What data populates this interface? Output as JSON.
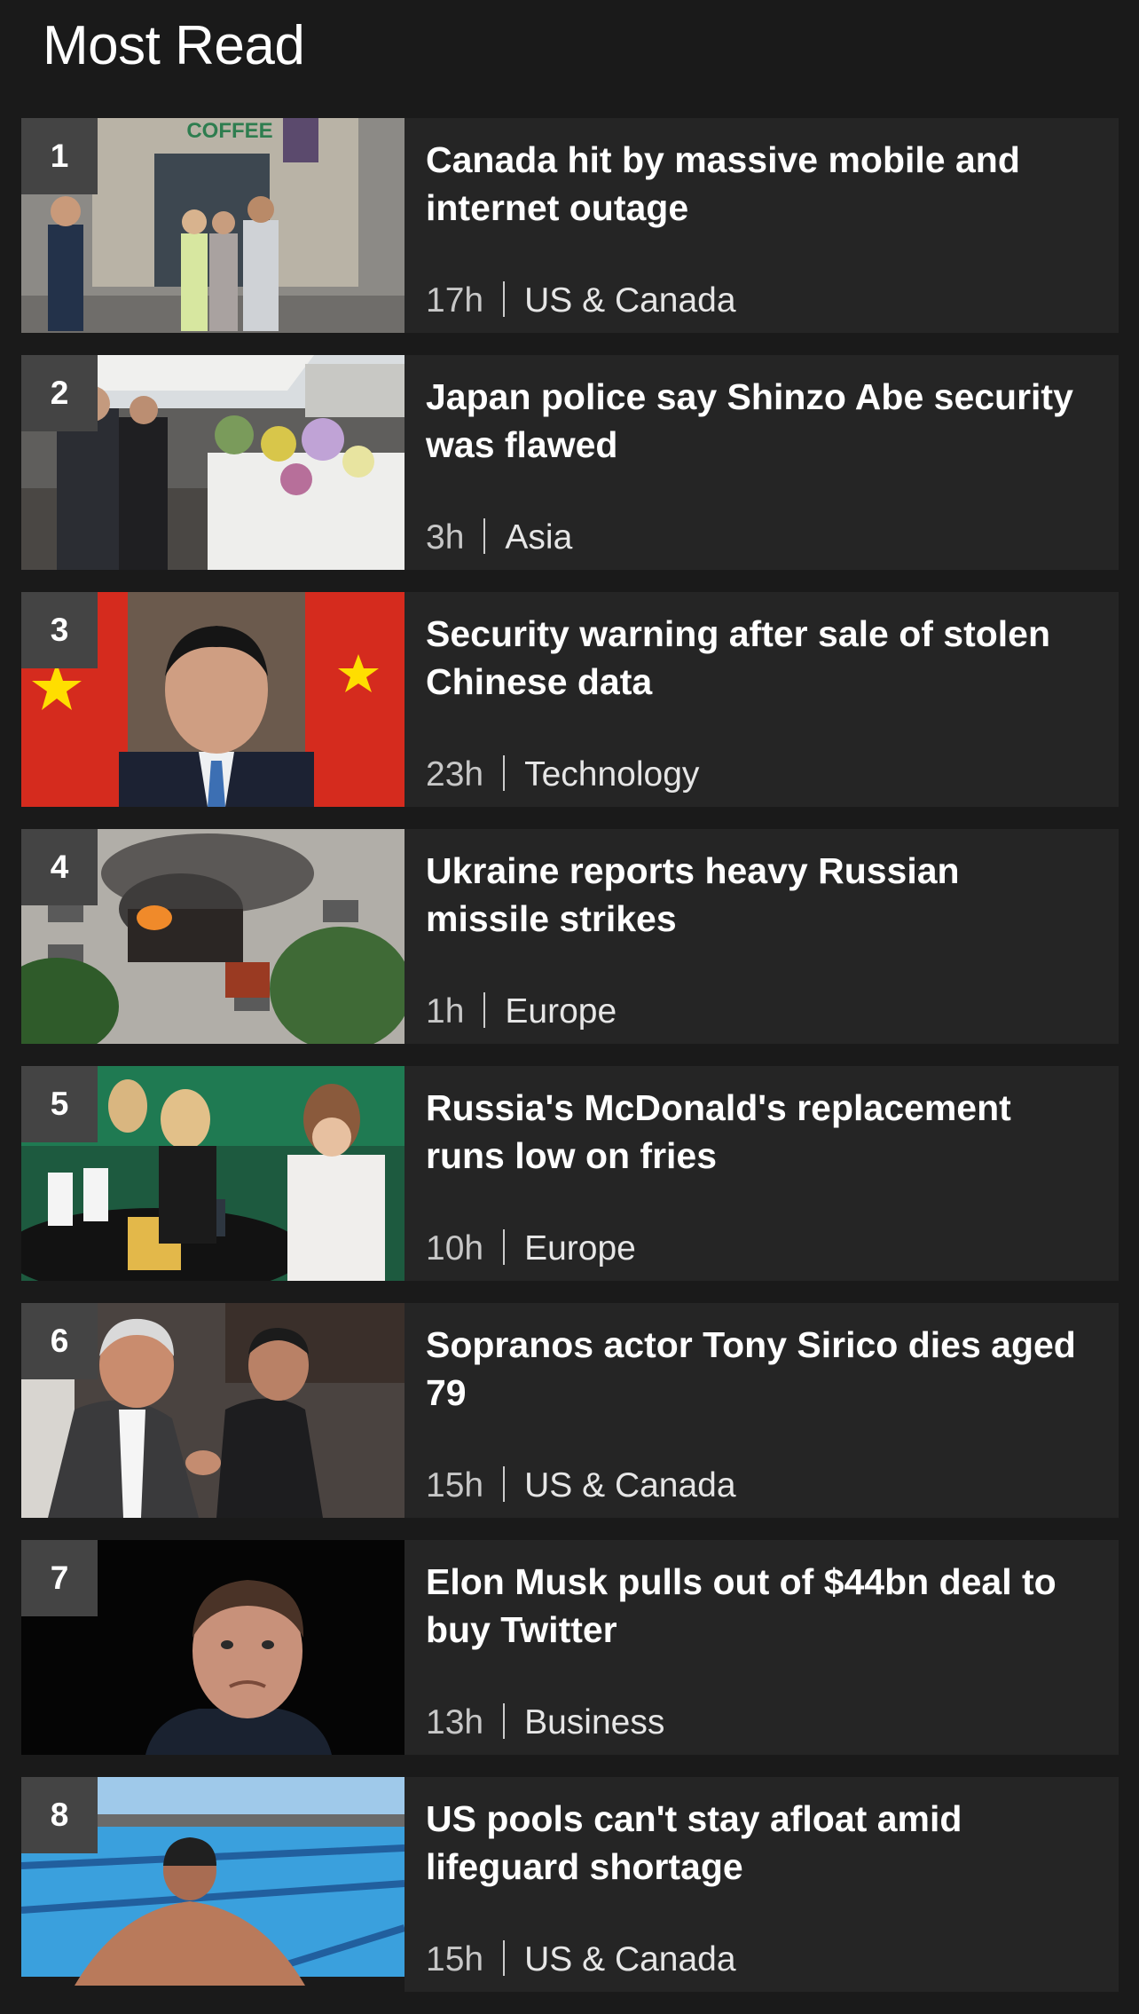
{
  "section": {
    "title": "Most Read"
  },
  "articles": [
    {
      "rank": "1",
      "headline": "Canada hit by massive mobile and internet outage",
      "time": "17h",
      "section": "US & Canada",
      "image": "people-outside-coffee-shop-photo",
      "image_text": "COFFEE"
    },
    {
      "rank": "2",
      "headline": "Japan police say Shinzo Abe security was flawed",
      "time": "3h",
      "section": "Asia",
      "image": "flower-memorial-photo"
    },
    {
      "rank": "3",
      "headline": "Security warning after sale of stolen Chinese data",
      "time": "23h",
      "section": "Technology",
      "image": "man-in-front-of-flags-photo"
    },
    {
      "rank": "4",
      "headline": "Ukraine reports heavy Russian missile strikes",
      "time": "1h",
      "section": "Europe",
      "image": "burning-apartment-building-photo"
    },
    {
      "rank": "5",
      "headline": "Russia's McDonald's replacement runs low on fries",
      "time": "10h",
      "section": "Europe",
      "image": "teens-eating-fries-photo"
    },
    {
      "rank": "6",
      "headline": "Sopranos actor Tony Sirico dies aged 79",
      "time": "15h",
      "section": "US & Canada",
      "image": "two-men-shaking-hands-photo"
    },
    {
      "rank": "7",
      "headline": "Elon Musk pulls out of $44bn deal to buy Twitter",
      "time": "13h",
      "section": "Business",
      "image": "man-portrait-dark-background-photo"
    },
    {
      "rank": "8",
      "headline": "US pools can't stay afloat amid lifeguard shortage",
      "time": "15h",
      "section": "US & Canada",
      "image": "swimmer-in-pool-photo"
    }
  ],
  "colors": {
    "background": "#1a1a1a",
    "card": "#252525",
    "rank_badge": "#444444",
    "text": "#ffffff",
    "meta_text": "#e6e6e6"
  }
}
